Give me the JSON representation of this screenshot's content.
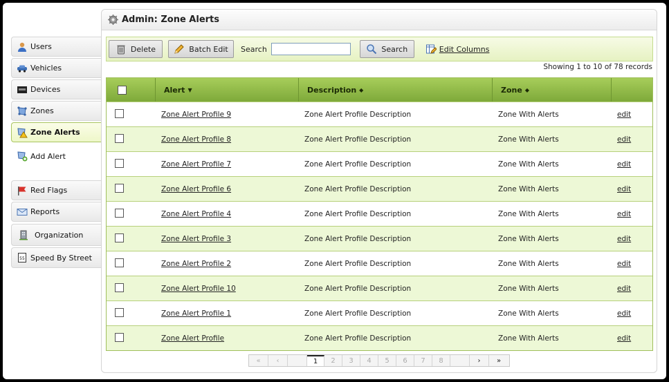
{
  "header": {
    "title": "Admin: Zone Alerts"
  },
  "sidebar": {
    "items": [
      {
        "label": "Users",
        "icon": "user-icon"
      },
      {
        "label": "Vehicles",
        "icon": "car-icon"
      },
      {
        "label": "Devices",
        "icon": "device-icon"
      },
      {
        "label": "Zones",
        "icon": "zone-icon"
      },
      {
        "label": "Zone Alerts",
        "icon": "zone-alert-icon"
      },
      {
        "label": "Add Alert",
        "icon": "add-alert-icon"
      },
      {
        "label": "Red Flags",
        "icon": "red-flag-icon"
      },
      {
        "label": "Reports",
        "icon": "envelope-icon"
      },
      {
        "label": "Organization",
        "icon": "building-icon"
      },
      {
        "label": "Speed By Street",
        "icon": "speed-sign-icon"
      }
    ]
  },
  "toolbar": {
    "delete_label": "Delete",
    "batch_edit_label": "Batch Edit",
    "search_label": "Search",
    "search_value": "",
    "search_button_label": "Search",
    "edit_columns_label": "Edit Columns"
  },
  "records_text": "Showing 1 to 10 of 78 records",
  "table": {
    "columns": [
      "Alert",
      "Description",
      "Zone"
    ],
    "rows": [
      {
        "alert": "Zone Alert Profile 9",
        "description": "Zone Alert Profile Description",
        "zone": "Zone With Alerts",
        "action": "edit"
      },
      {
        "alert": "Zone Alert Profile 8",
        "description": "Zone Alert Profile Description",
        "zone": "Zone With Alerts",
        "action": "edit"
      },
      {
        "alert": "Zone Alert Profile 7",
        "description": "Zone Alert Profile Description",
        "zone": "Zone With Alerts",
        "action": "edit"
      },
      {
        "alert": "Zone Alert Profile 6",
        "description": "Zone Alert Profile Description",
        "zone": "Zone With Alerts",
        "action": "edit"
      },
      {
        "alert": "Zone Alert Profile 4",
        "description": "Zone Alert Profile Description",
        "zone": "Zone With Alerts",
        "action": "edit"
      },
      {
        "alert": "Zone Alert Profile 3",
        "description": "Zone Alert Profile Description",
        "zone": "Zone With Alerts",
        "action": "edit"
      },
      {
        "alert": "Zone Alert Profile 2",
        "description": "Zone Alert Profile Description",
        "zone": "Zone With Alerts",
        "action": "edit"
      },
      {
        "alert": "Zone Alert Profile 10",
        "description": "Zone Alert Profile Description",
        "zone": "Zone With Alerts",
        "action": "edit"
      },
      {
        "alert": "Zone Alert Profile 1",
        "description": "Zone Alert Profile Description",
        "zone": "Zone With Alerts",
        "action": "edit"
      },
      {
        "alert": "Zone Alert Profile",
        "description": "Zone Alert Profile Description",
        "zone": "Zone With Alerts",
        "action": "edit"
      }
    ]
  },
  "pager": {
    "first": "«",
    "prev": "‹",
    "pages": [
      "1",
      "2",
      "3",
      "4",
      "5",
      "6",
      "7",
      "8"
    ],
    "current": "1",
    "next": "›",
    "last": "»"
  },
  "colors": {
    "accent_green": "#8fb946",
    "row_alt": "#edf8d6",
    "toolbar_bg": "#eef6d6"
  }
}
